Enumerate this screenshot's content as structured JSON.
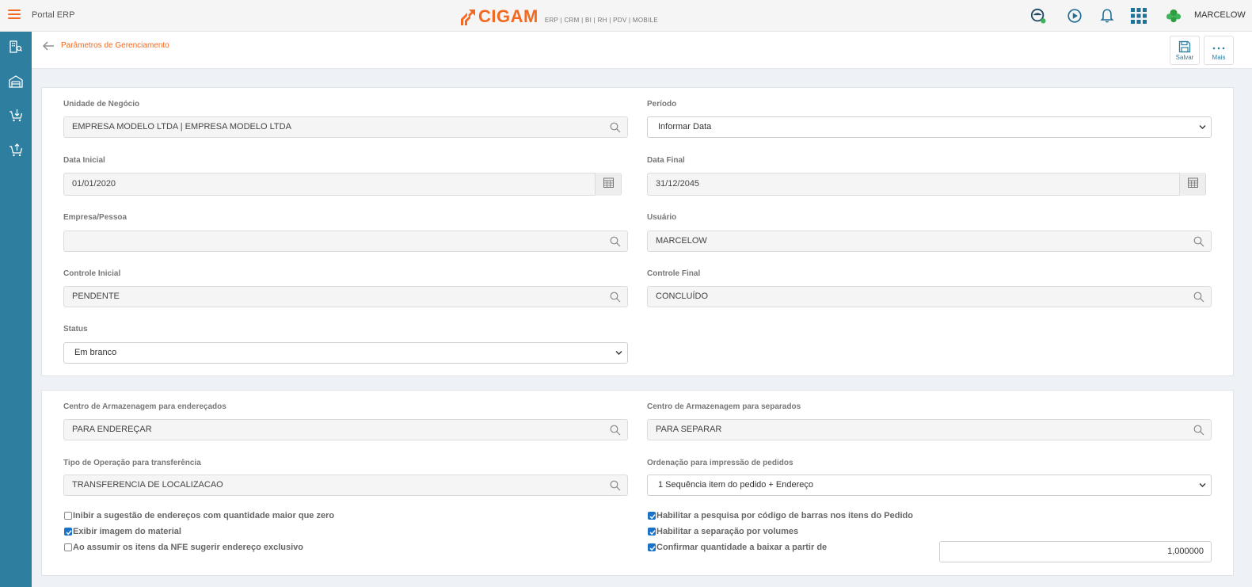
{
  "header": {
    "app_title": "Portal ERP",
    "brand": "CIGAM",
    "brand_modules": "ERP | CRM | BI | RH | PDV | MOBILE",
    "user": "MARCELOW",
    "colors": {
      "accent": "#f26a21",
      "sidebar": "#2e7ea0",
      "checkbox": "#1a73c8"
    },
    "icons": [
      "chat-support-icon",
      "play-circle-icon",
      "bell-icon",
      "apps-grid-icon",
      "user-avatar-icon"
    ]
  },
  "sidebar": {
    "icons": [
      "building-search-icon",
      "warehouse-icon",
      "cart-download-icon",
      "cart-upload-icon"
    ]
  },
  "subheader": {
    "breadcrumb": "Parâmetros de Gerenciamento",
    "save_label": "Salvar",
    "more_label": "Mais"
  },
  "form1": {
    "unidade_label": "Unidade de Negócio",
    "unidade_value": "EMPRESA MODELO LTDA | EMPRESA MODELO LTDA",
    "periodo_label": "Período",
    "periodo_value": "Informar Data",
    "data_inicial_label": "Data Inicial",
    "data_inicial_value": "01/01/2020",
    "data_final_label": "Data Final",
    "data_final_value": "31/12/2045",
    "empresa_label": "Empresa/Pessoa",
    "empresa_value": "",
    "usuario_label": "Usuário",
    "usuario_value": "MARCELOW",
    "controle_inicial_label": "Controle Inicial",
    "controle_inicial_value": "PENDENTE",
    "controle_final_label": "Controle Final",
    "controle_final_value": "CONCLUÍDO",
    "status_label": "Status",
    "status_value": "Em branco"
  },
  "form2": {
    "centro_end_label": "Centro de Armazenagem para endereçados",
    "centro_end_value": "PARA ENDEREÇAR",
    "centro_sep_label": "Centro de Armazenagem para separados",
    "centro_sep_value": "PARA SEPARAR",
    "tipo_op_label": "Tipo de Operação para transferência",
    "tipo_op_value": "TRANSFERENCIA DE LOCALIZACAO",
    "ordenacao_label": "Ordenação para impressão de pedidos",
    "ordenacao_value": "1 Sequência item do pedido + Endereço",
    "checkboxes_left": [
      {
        "label": "Inibir a sugestão de endereços com quantidade maior que zero",
        "checked": false
      },
      {
        "label": "Exibir imagem do material",
        "checked": true
      },
      {
        "label": "Ao assumir os itens da NFE sugerir endereço exclusivo",
        "checked": false
      }
    ],
    "checkboxes_right": [
      {
        "label": "Habilitar a pesquisa por código de barras nos itens do Pedido",
        "checked": true
      },
      {
        "label": "Habilitar a separação por volumes",
        "checked": true
      },
      {
        "label": "Confirmar quantidade a baixar a partir de",
        "checked": true
      }
    ],
    "quantidade_value": "1,000000"
  }
}
